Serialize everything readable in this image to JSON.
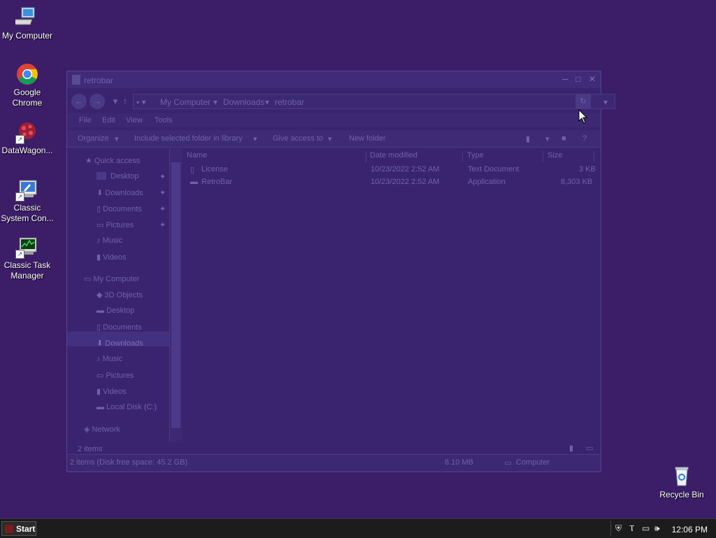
{
  "desktop": {
    "icons": [
      {
        "label": "My Computer",
        "icon": "computer-icon"
      },
      {
        "label": "Google Chrome",
        "icon": "chrome-icon"
      },
      {
        "label": "DataWagon...",
        "icon": "datawagon-icon"
      },
      {
        "label": "Classic System Con...",
        "icon": "control-panel-icon"
      },
      {
        "label": "Classic Task Manager",
        "icon": "task-manager-icon"
      },
      {
        "label": "Recycle Bin",
        "icon": "recycle-bin-icon"
      }
    ]
  },
  "window": {
    "title": "retrobar",
    "controls": {
      "minimize": "─",
      "maximize": "□",
      "close": "✕"
    },
    "breadcrumb": [
      "My Computer",
      "Downloads",
      "retrobar"
    ],
    "menu": [
      "File",
      "Edit",
      "View",
      "Tools"
    ],
    "commands": [
      "Organize",
      "Include selected folder in library",
      "Give access to",
      "New folder"
    ],
    "nav": {
      "quick_access": "Quick access",
      "quick_items": [
        "Desktop",
        "Downloads",
        "Documents",
        "Pictures",
        "Music",
        "Videos"
      ],
      "my_computer": "My Computer",
      "computer_items": [
        "3D Objects",
        "Desktop",
        "Documents",
        "Downloads",
        "Music",
        "Pictures",
        "Videos",
        "Local Disk (C:)"
      ],
      "network": "Network"
    },
    "columns": [
      "Name",
      "Date modified",
      "Type",
      "Size"
    ],
    "files": [
      {
        "name": "License",
        "date": "10/23/2022 2:52 AM",
        "type": "Text Document",
        "size": "3 KB"
      },
      {
        "name": "RetroBar",
        "date": "10/23/2022 2:52 AM",
        "type": "Application",
        "size": "8,303 KB"
      }
    ],
    "item_count": "2 items",
    "status": {
      "summary": "2 items (Disk free space: 45.2 GB)",
      "size": "8.10 MB",
      "location": "Computer"
    }
  },
  "taskbar": {
    "start_label": "Start",
    "clock": "12:06 PM"
  }
}
